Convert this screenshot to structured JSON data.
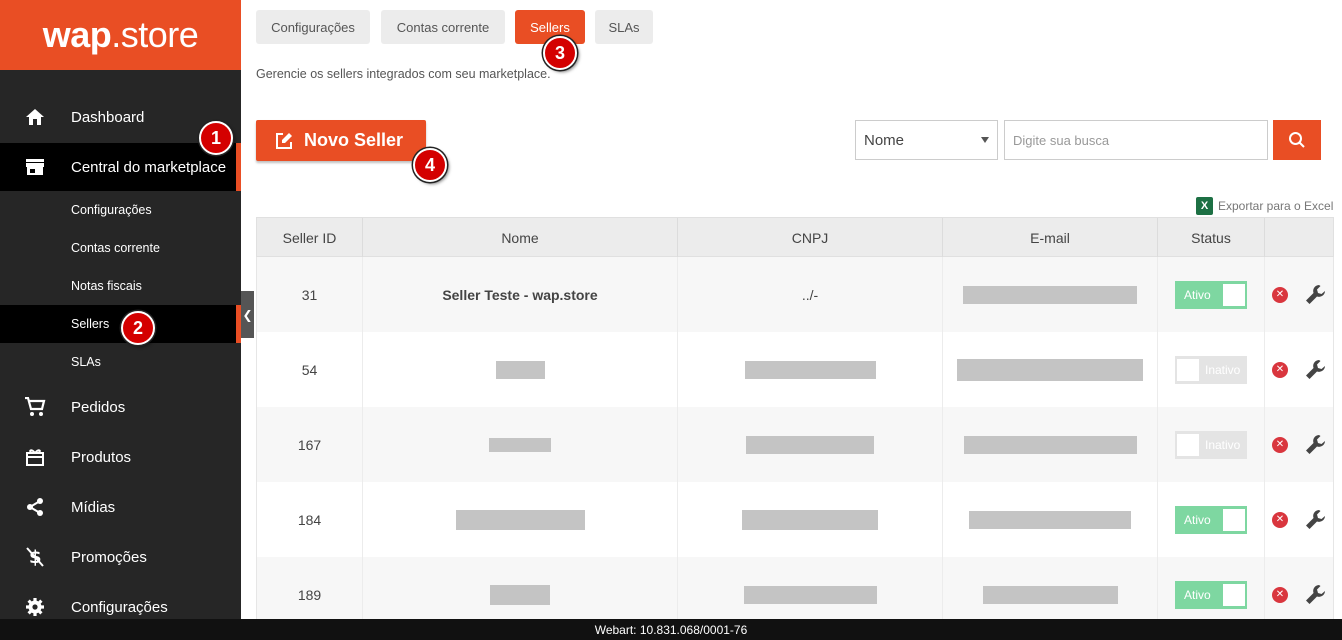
{
  "logo": {
    "bold": "wap",
    "rest": ".store"
  },
  "sidebar": {
    "items": [
      {
        "label": "Dashboard",
        "icon": "home-icon"
      },
      {
        "label": "Central do marketplace",
        "icon": "store-icon"
      },
      {
        "label": "Pedidos",
        "icon": "cart-icon"
      },
      {
        "label": "Produtos",
        "icon": "gift-icon"
      },
      {
        "label": "Mídias",
        "icon": "share-icon"
      },
      {
        "label": "Promoções",
        "icon": "dollar-icon"
      },
      {
        "label": "Configurações",
        "icon": "gear-icon"
      }
    ],
    "subitems": [
      "Configurações",
      "Contas corrente",
      "Notas fiscais",
      "Sellers",
      "SLAs"
    ]
  },
  "tabs": [
    "Configurações",
    "Contas corrente",
    "Sellers",
    "SLAs"
  ],
  "description": "Gerencie os sellers integrados com seu marketplace.",
  "new_button": "Novo Seller",
  "filter": {
    "selected": "Nome",
    "placeholder": "Digite sua busca"
  },
  "export_label": "Exportar para o Excel",
  "table": {
    "headers": [
      "Seller ID",
      "Nome",
      "CNPJ",
      "E-mail",
      "Status"
    ],
    "rows": [
      {
        "id": "31",
        "name": "Seller Teste - wap.store",
        "cnpj": "../-",
        "status": "Ativo"
      },
      {
        "id": "54",
        "status": "Inativo"
      },
      {
        "id": "167",
        "status": "Inativo"
      },
      {
        "id": "184",
        "status": "Ativo"
      },
      {
        "id": "189",
        "status": "Ativo"
      }
    ]
  },
  "badges": [
    "1",
    "2",
    "3",
    "4"
  ],
  "footer": "Webart: 10.831.068/0001-76",
  "colors": {
    "accent": "#e94e24",
    "sidebar": "#262626",
    "active_toggle": "#7ed7a1"
  }
}
